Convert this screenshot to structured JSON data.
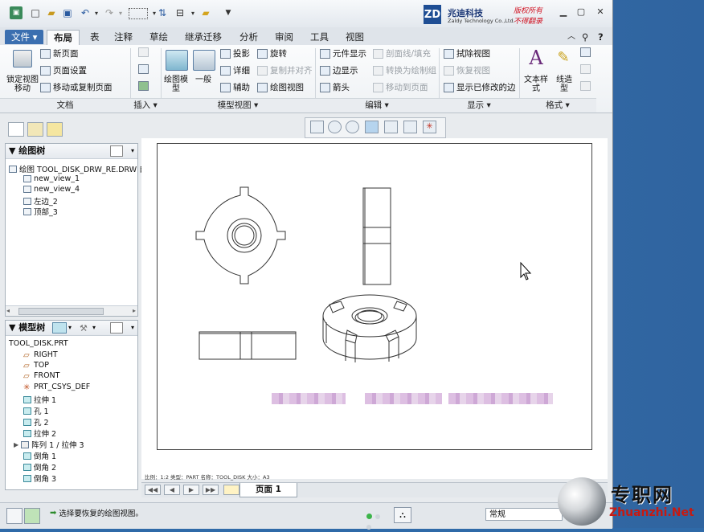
{
  "quick_access": {
    "icons": [
      "app-icon",
      "new-icon",
      "open-icon",
      "save-icon",
      "undo-icon",
      "redo-icon",
      "select-box-icon",
      "regenerate-icon",
      "windows-icon",
      "folder-icon",
      "customize-icon"
    ]
  },
  "logo": {
    "box": "ZD",
    "cn": "兆迪科技",
    "en": "Zaldy Technology Co.,Ltd.",
    "note1": "版权所有",
    "note2": "不得翻录"
  },
  "tabs": [
    "文件",
    "布局",
    "表",
    "注释",
    "草绘",
    "继承迁移",
    "分析",
    "审阅",
    "工具",
    "视图"
  ],
  "ribbon": {
    "doc_group": {
      "lock": "锁定视图移动",
      "new_page": "新页面",
      "page_setup": "页面设置",
      "move_copy": "移动或复制页面",
      "label": "文档"
    },
    "insert_group": {
      "label": "插入"
    },
    "model_views": {
      "drawing_model": "绘图模型",
      "general": "一般",
      "projection": "投影",
      "detail": "详细",
      "auxiliary": "辅助",
      "rotate": "旋转",
      "copy_align": "复制并对齐",
      "drawing_view": "绘图视图",
      "label": "模型视图"
    },
    "edit": {
      "element_display": "元件显示",
      "edge_display": "边显示",
      "arrow": "箭头",
      "section_fill": "剖面线/填充",
      "convert_group": "转换为绘制组",
      "move_to_page": "移动到页面",
      "label": "编辑"
    },
    "display": {
      "erase_view": "拭除视图",
      "restore_view": "恢复视图",
      "show_modified": "显示已修改的边",
      "label": "显示"
    },
    "format": {
      "text_style": "文本样式",
      "line_style": "线造型",
      "label": "格式"
    }
  },
  "drawing_tree": {
    "title": "绘图树",
    "root": "绘图 TOOL_DISK_DRW_RE.DRW 自",
    "items": [
      "new_view_1",
      "new_view_4",
      "左边_2",
      "顶部_3"
    ]
  },
  "model_tree": {
    "title": "模型树",
    "root": "TOOL_DISK.PRT",
    "items": [
      "RIGHT",
      "TOP",
      "FRONT",
      "PRT_CSYS_DEF",
      "拉伸 1",
      "孔 1",
      "孔 2",
      "拉伸 2",
      "阵列 1 / 拉伸 3",
      "倒角 1",
      "倒角 2",
      "倒角 3"
    ]
  },
  "sheet_info": "比例：1:2    类型：PART    名称：TOOL_DISK    大小：A3",
  "page_tab": "页面 1",
  "status": {
    "message": "选择要恢复的绘图视图。",
    "filter": "常规"
  },
  "watermark": {
    "cn": "专职网",
    "en": "Zhuanzhi.Net"
  }
}
